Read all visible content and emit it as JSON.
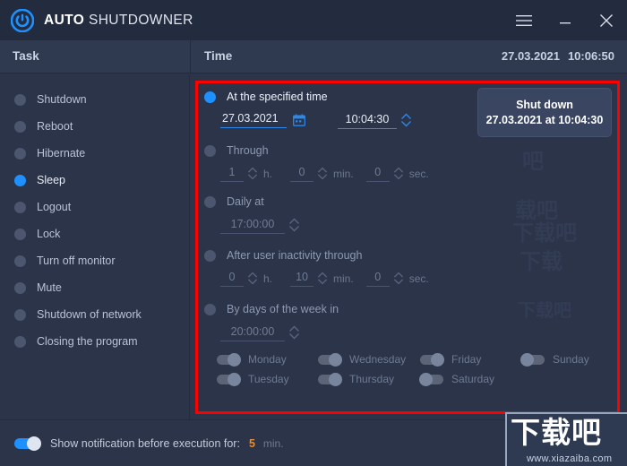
{
  "window": {
    "brand_bold": "AUTO",
    "brand_rest": "SHUTDOWNER",
    "power_icon": "power-icon",
    "menu_icon": "hamburger-menu-icon",
    "minimize_icon": "minimize-icon",
    "close_icon": "close-icon"
  },
  "columns": {
    "task_header": "Task",
    "time_header": "Time",
    "clock_date": "27.03.2021",
    "clock_time": "10:06:50"
  },
  "tasks": {
    "items": [
      {
        "label": "Shutdown",
        "selected": false
      },
      {
        "label": "Reboot",
        "selected": false
      },
      {
        "label": "Hibernate",
        "selected": false
      },
      {
        "label": "Sleep",
        "selected": true
      },
      {
        "label": "Logout",
        "selected": false
      },
      {
        "label": "Lock",
        "selected": false
      },
      {
        "label": "Turn off monitor",
        "selected": false
      },
      {
        "label": "Mute",
        "selected": false
      },
      {
        "label": "Shutdown of network",
        "selected": false
      },
      {
        "label": "Closing the program",
        "selected": false
      }
    ]
  },
  "time_options": {
    "specified": {
      "label": "At the specified time",
      "selected": true,
      "date": "27.03.2021",
      "time": "10:04:30",
      "calendar_icon": "calendar-icon",
      "spinner_icon": "spinner-up-down-icon"
    },
    "through": {
      "label": "Through",
      "selected": false,
      "hours": "1",
      "hours_unit": "h.",
      "minutes": "0",
      "minutes_unit": "min.",
      "seconds": "0",
      "seconds_unit": "sec."
    },
    "daily": {
      "label": "Daily at",
      "selected": false,
      "time": "17:00:00"
    },
    "inactivity": {
      "label": "After user inactivity through",
      "selected": false,
      "hours": "0",
      "hours_unit": "h.",
      "minutes": "10",
      "minutes_unit": "min.",
      "seconds": "0",
      "seconds_unit": "sec."
    },
    "weekdays": {
      "label": "By days of the week in",
      "selected": false,
      "time": "20:00:00",
      "days": [
        {
          "label": "Monday",
          "on": true
        },
        {
          "label": "Tuesday",
          "on": true
        },
        {
          "label": "Wednesday",
          "on": true
        },
        {
          "label": "Thursday",
          "on": true
        },
        {
          "label": "Friday",
          "on": true
        },
        {
          "label": "Saturday",
          "on": false
        },
        {
          "label": "Sunday",
          "on": false
        }
      ]
    }
  },
  "action_button": {
    "line1": "Shut down",
    "line2": "27.03.2021 at 10:04:30"
  },
  "footer": {
    "notification_label": "Show notification before execution for:",
    "notification_minutes": "5",
    "notification_unit": "min.",
    "notification_on": true
  },
  "watermark": {
    "text_cn": "下载吧",
    "url": "www.xiazaiba.com"
  },
  "colors": {
    "accent_blue": "#1e90ff",
    "highlight_red": "#ff0000",
    "orange": "#f08a1e",
    "panel_bg": "#2b3448",
    "titlebar_bg": "#232c3f"
  }
}
